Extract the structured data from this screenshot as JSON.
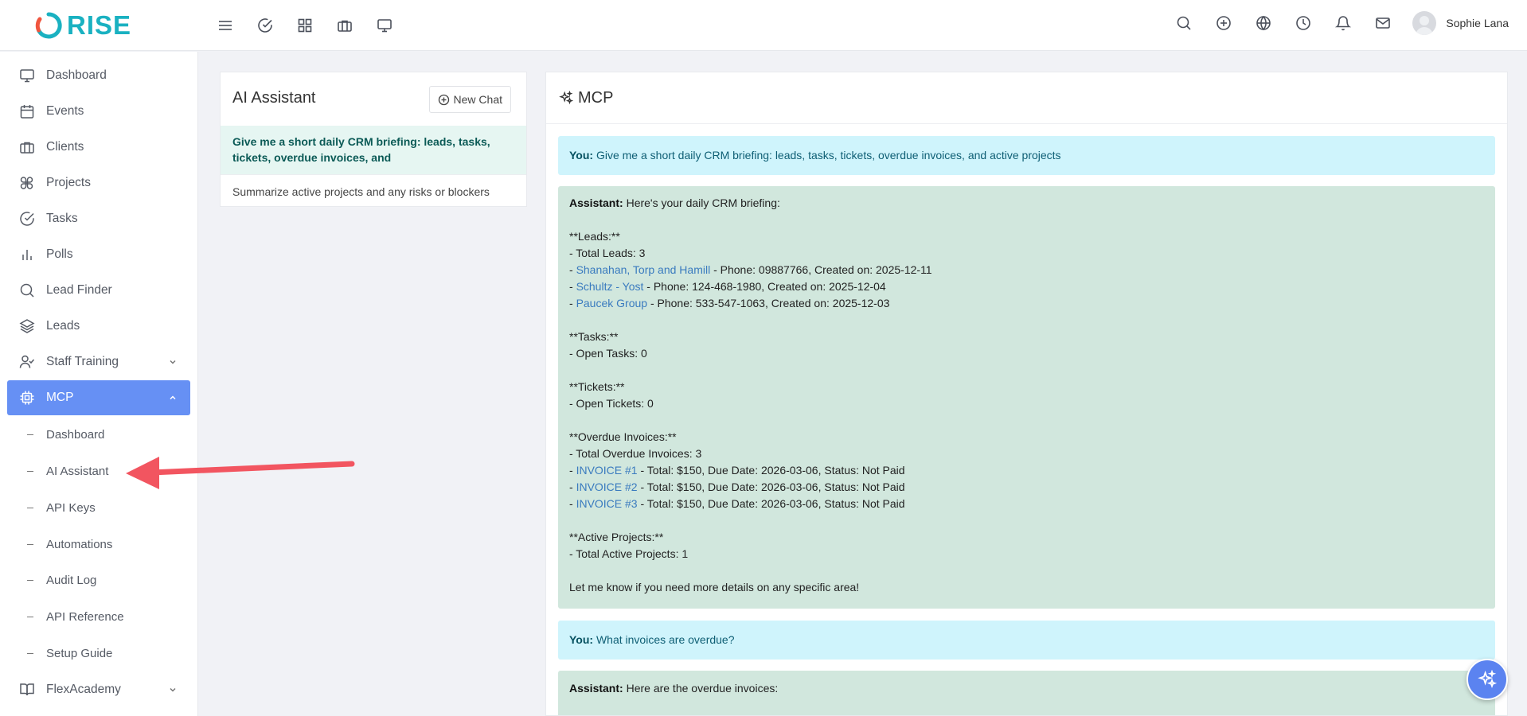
{
  "brand": {
    "name": "RISE",
    "color": "#1ab1c1"
  },
  "header": {
    "left_icons": [
      "menu-icon",
      "check-circle-icon",
      "grid-icon",
      "briefcase-icon",
      "monitor-icon"
    ],
    "right_icons": [
      "search-icon",
      "plus-circle-icon",
      "globe-icon",
      "clock-icon",
      "bell-icon",
      "mail-icon"
    ],
    "user_name": "Sophie Lana"
  },
  "sidebar": {
    "items": [
      {
        "label": "Dashboard",
        "icon": "monitor-icon"
      },
      {
        "label": "Events",
        "icon": "calendar-icon"
      },
      {
        "label": "Clients",
        "icon": "briefcase-icon"
      },
      {
        "label": "Projects",
        "icon": "command-icon"
      },
      {
        "label": "Tasks",
        "icon": "check-circle-icon"
      },
      {
        "label": "Polls",
        "icon": "bar-chart-icon"
      },
      {
        "label": "Lead Finder",
        "icon": "search-icon"
      },
      {
        "label": "Leads",
        "icon": "layers-icon"
      },
      {
        "label": "Staff Training",
        "icon": "user-check-icon"
      },
      {
        "label": "MCP",
        "icon": "cpu-icon"
      }
    ],
    "mcp_sub": [
      "Dashboard",
      "AI Assistant",
      "API Keys",
      "Automations",
      "Audit Log",
      "API Reference",
      "Setup Guide"
    ],
    "bottom_item": {
      "label": "FlexAcademy",
      "icon": "book-icon"
    },
    "active_color": "#6690f4"
  },
  "chats_panel": {
    "title": "AI Assistant",
    "new_chat_label": "New Chat",
    "conversations": [
      "Give me a short daily CRM briefing: leads, tasks, tickets, overdue invoices, and",
      "Summarize active projects and any risks or blockers"
    ]
  },
  "chat_panel": {
    "title": "MCP",
    "you_prefix": "You:",
    "assistant_prefix": "Assistant:",
    "msg1": "Give me a short daily CRM briefing: leads, tasks, tickets, overdue invoices, and active projects",
    "reply1": {
      "intro": "Here's your daily CRM briefing:",
      "leads_h": "**Leads:**",
      "leads_total": "- Total Leads: 3",
      "lead1_name": "Shanahan, Torp and Hamill",
      "lead1_rest": " - Phone: 09887766, Created on: 2025-12-11",
      "lead2_name": "Schultz - Yost",
      "lead2_rest": " - Phone: 124-468-1980, Created on: 2025-12-04",
      "lead3_name": "Paucek Group",
      "lead3_rest": " - Phone: 533-547-1063, Created on: 2025-12-03",
      "tasks_h": "**Tasks:**",
      "tasks_open": "- Open Tasks: 0",
      "tickets_h": "**Tickets:**",
      "tickets_open": "- Open Tickets: 0",
      "inv_h": "**Overdue Invoices:**",
      "inv_total": "- Total Overdue Invoices: 3",
      "inv1_name": "INVOICE #1",
      "inv2_name": "INVOICE #2",
      "inv3_name": "INVOICE #3",
      "inv_rest": " - Total: $150, Due Date: 2026-03-06, Status: Not Paid",
      "proj_h": "**Active Projects:**",
      "proj_total": "- Total Active Projects: 1",
      "outro": "Let me know if you need more details on any specific area!"
    },
    "msg2": "What invoices are overdue?",
    "reply2_intro": "Here are the overdue invoices:",
    "dash_prefix": "- "
  }
}
